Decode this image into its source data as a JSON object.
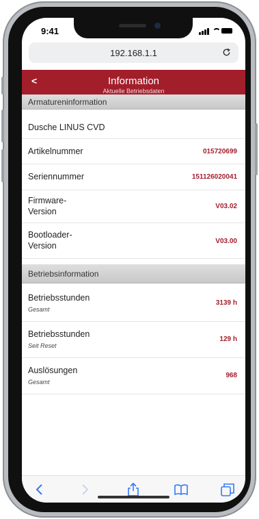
{
  "status": {
    "time": "9:41"
  },
  "browser": {
    "url": "192.168.1.1"
  },
  "header": {
    "back_label": "<",
    "title": "Information",
    "subtitle": "Aktuelle Betriebsdaten"
  },
  "sections": [
    {
      "title": "Armatureninformation",
      "rows": [
        {
          "label": "Dusche LINUS CVD",
          "value": ""
        },
        {
          "label": "Artikelnummer",
          "value": "015720699"
        },
        {
          "label": "Seriennummer",
          "value": "151126020041"
        },
        {
          "label": "Firmware-\nVersion",
          "value": "V03.02"
        },
        {
          "label": "Bootloader-\nVersion",
          "value": "V03.00"
        }
      ]
    },
    {
      "title": "Betriebsinformation",
      "rows": [
        {
          "label": "Betriebsstunden",
          "sublabel": "Gesamt",
          "value": "3139 h"
        },
        {
          "label": "Betriebsstunden",
          "sublabel": "Seit Reset",
          "value": "129 h"
        },
        {
          "label": "Auslösungen",
          "sublabel": "Gesamt",
          "value": "968"
        }
      ]
    }
  ],
  "toolbar": {
    "icons": [
      "back-icon",
      "forward-icon",
      "share-icon",
      "bookmarks-icon",
      "tabs-icon"
    ],
    "accent": "#3478f6"
  },
  "colors": {
    "brand": "#a31e2b",
    "value_text": "#a31e2b"
  }
}
